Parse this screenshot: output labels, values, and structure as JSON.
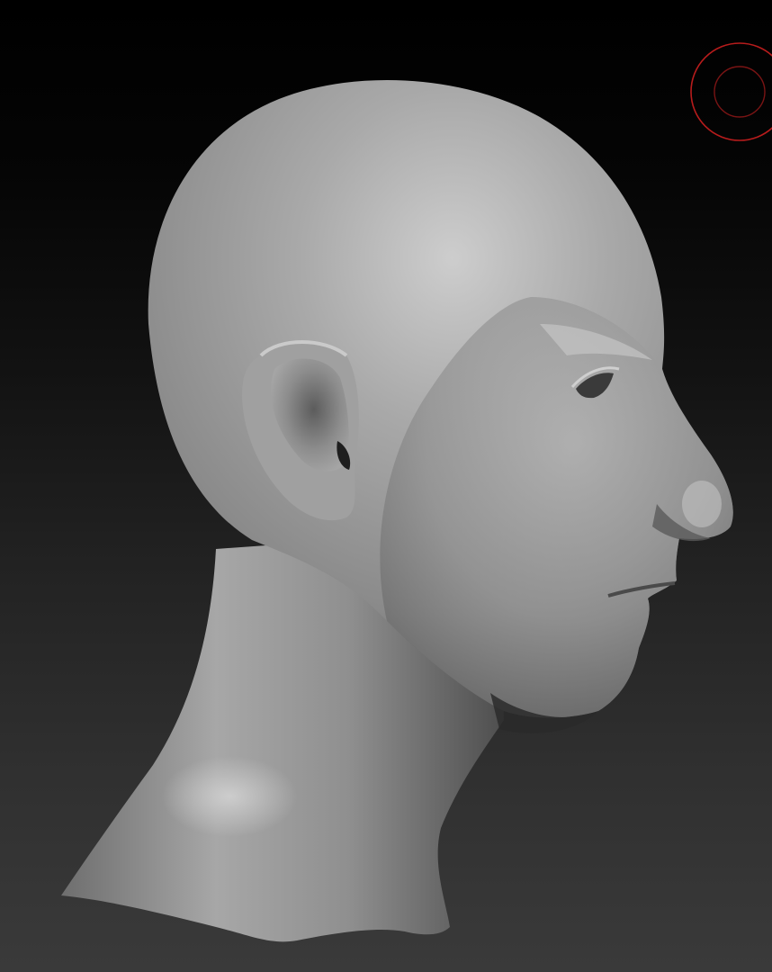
{
  "canvas": {
    "background_top": "#000000",
    "background_bottom": "#3a3a3a"
  },
  "model": {
    "icon": "sculpt-head-model",
    "material_color": "#9a9a9a",
    "highlight_color": "#c8c8c8",
    "shadow_color": "#3c3c3c"
  },
  "brush_cursor": {
    "icon": "brush-cursor-icon",
    "color": "#b81c1c"
  }
}
